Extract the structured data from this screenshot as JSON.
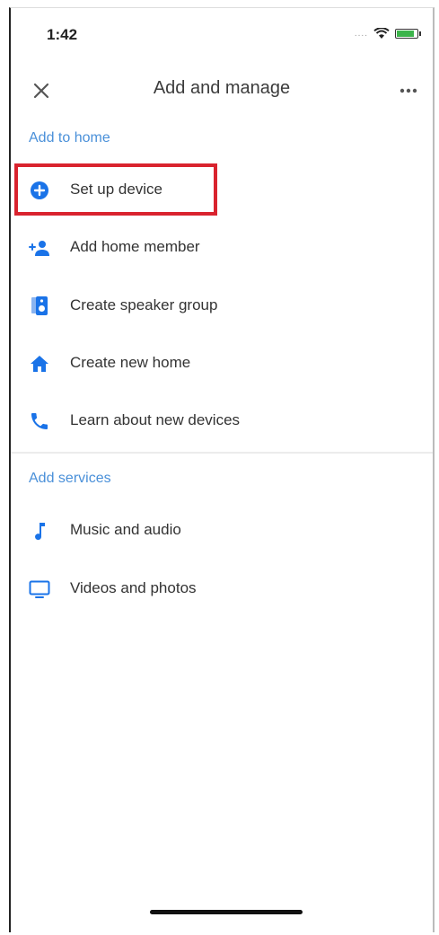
{
  "status_bar": {
    "time": "1:42",
    "signal_dots": "....",
    "battery_level": 0.8
  },
  "header": {
    "title": "Add and manage"
  },
  "sections": [
    {
      "title": "Add to home",
      "items": [
        {
          "label": "Set up device",
          "icon": "add-circle-icon"
        },
        {
          "label": "Add home member",
          "icon": "add-person-icon"
        },
        {
          "label": "Create speaker group",
          "icon": "speaker-icon"
        },
        {
          "label": "Create new home",
          "icon": "home-icon"
        },
        {
          "label": "Learn about new devices",
          "icon": "phone-icon"
        }
      ]
    },
    {
      "title": "Add services",
      "items": [
        {
          "label": "Music and audio",
          "icon": "music-note-icon"
        },
        {
          "label": "Videos and photos",
          "icon": "tv-icon"
        }
      ]
    }
  ],
  "colors": {
    "accent": "#1a73e8",
    "section_header": "#4a90d9",
    "highlight": "#d9232e"
  }
}
